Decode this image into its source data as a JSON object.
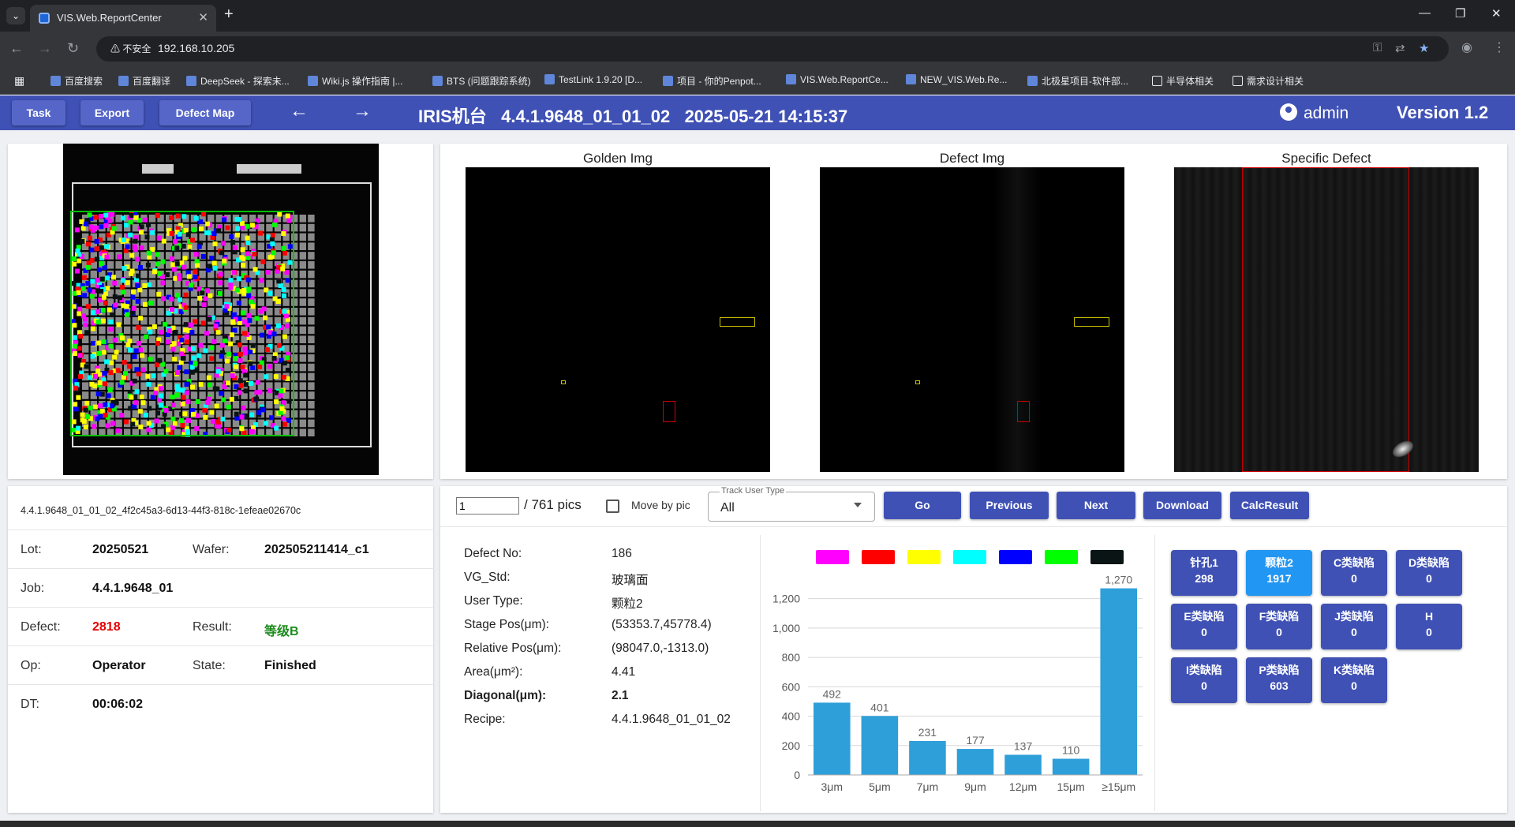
{
  "browser": {
    "tab_title": "VIS.Web.ReportCenter",
    "security_label": "不安全",
    "url": "192.168.10.205",
    "bookmarks": [
      "百度搜索",
      "百度翻译",
      "DeepSeek - 探索未...",
      "Wiki.js 操作指南 |...",
      "BTS (问题跟踪系统)",
      "TestLink 1.9.20 [D...",
      "项目 - 你的Penpot...",
      "VIS.Web.ReportCe...",
      "NEW_VIS.Web.Re...",
      "北极星项目-软件部...",
      "半导体相关",
      "需求设计相关"
    ]
  },
  "appbar": {
    "task": "Task",
    "export": "Export",
    "defect_map": "Defect Map",
    "prev_arrow": "←",
    "next_arrow": "→",
    "title": "IRIS机台   4.4.1.9648_01_01_02   2025-05-21 14:15:37",
    "user": "admin",
    "version": "Version 1.2"
  },
  "images": {
    "golden": "Golden Img",
    "defect": "Defect Img",
    "specific": "Specific Defect"
  },
  "info": {
    "id": "4.4.1.9648_01_01_02_4f2c45a3-6d13-44f3-818c-1efeae02670c",
    "lot_label": "Lot:",
    "lot": "20250521",
    "wafer_label": "Wafer:",
    "wafer": "202505211414_c1",
    "job_label": "Job:",
    "job": "4.4.1.9648_01",
    "defect_label": "Defect:",
    "defect": "2818",
    "result_label": "Result:",
    "result": "等级B",
    "op_label": "Op:",
    "op": "Operator",
    "state_label": "State:",
    "state": "Finished",
    "dt_label": "DT:",
    "dt": "00:06:02"
  },
  "controls": {
    "page_value": "1",
    "page_total": "/ 761 pics",
    "move_by_pic": "Move by pic",
    "track_label": "Track User Type",
    "track_value": "All",
    "go": "Go",
    "previous": "Previous",
    "next": "Next",
    "download": "Download",
    "calc": "CalcResult"
  },
  "defect_detail": [
    {
      "label": "Defect No:",
      "value": "186"
    },
    {
      "label": "VG_Std:",
      "value": "玻璃面"
    },
    {
      "label": "User Type:",
      "value": "颗粒2"
    },
    {
      "label": "Stage Pos(μm):",
      "value": "(53353.7,45778.4)"
    },
    {
      "label": "Relative Pos(μm):",
      "value": "(98047.0,-1313.0)"
    },
    {
      "label": "Area(μm²):",
      "value": "4.41"
    },
    {
      "label": "Diagonal(μm):",
      "value": "2.1"
    },
    {
      "label": "Recipe:",
      "value": "4.4.1.9648_01_01_02"
    }
  ],
  "legend_colors": [
    "#ff00ff",
    "#ff0000",
    "#ffff00",
    "#00ffff",
    "#0000ff",
    "#00ff00",
    "#0a1414"
  ],
  "chart_data": {
    "type": "bar",
    "categories": [
      "3μm",
      "5μm",
      "7μm",
      "9μm",
      "12μm",
      "15μm",
      "≥15μm"
    ],
    "values": [
      492,
      401,
      231,
      177,
      137,
      110,
      1270
    ],
    "ylim": [
      0,
      1300
    ],
    "yticks": [
      0,
      200,
      400,
      600,
      800,
      "1,000",
      "1,200"
    ],
    "value_labels": [
      "492",
      "401",
      "231",
      "177",
      "137",
      "110",
      "1,270"
    ],
    "bar_color": "#2e9fd9"
  },
  "categories": [
    {
      "name": "针孔1",
      "count": "298"
    },
    {
      "name": "颗粒2",
      "count": "1917"
    },
    {
      "name": "C类缺陷",
      "count": "0"
    },
    {
      "name": "D类缺陷",
      "count": "0"
    },
    {
      "name": "E类缺陷",
      "count": "0"
    },
    {
      "name": "F类缺陷",
      "count": "0"
    },
    {
      "name": "J类缺陷",
      "count": "0"
    },
    {
      "name": "H",
      "count": "0"
    },
    {
      "name": "I类缺陷",
      "count": "0"
    },
    {
      "name": "P类缺陷",
      "count": "603"
    },
    {
      "name": "K类缺陷",
      "count": "0"
    }
  ]
}
